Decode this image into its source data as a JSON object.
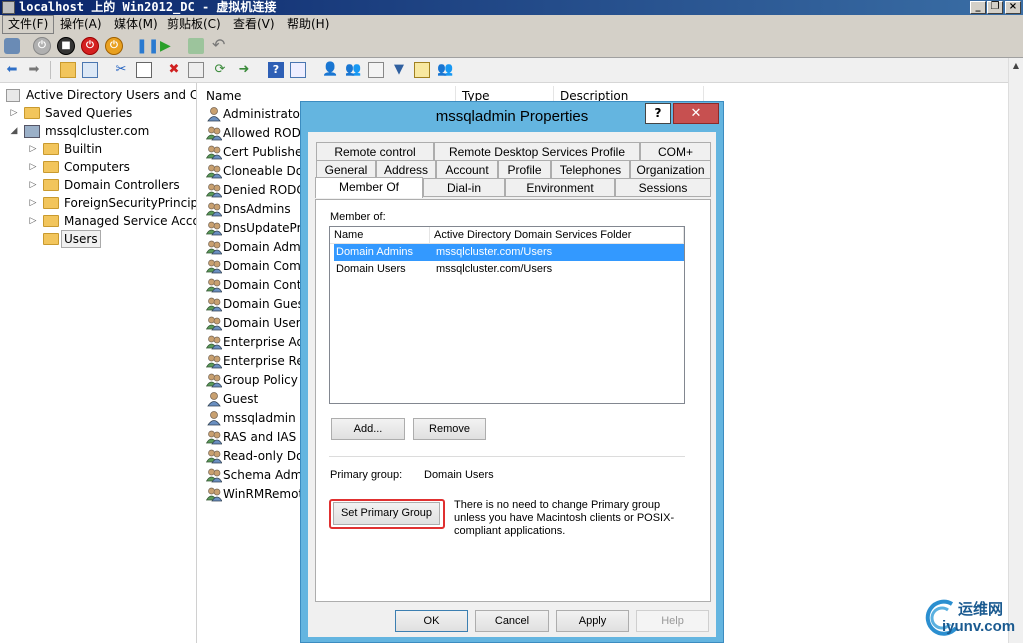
{
  "vm": {
    "title": "localhost 上的 Win2012_DC - 虚拟机连接",
    "menu": [
      "文件(F)",
      "操作(A)",
      "媒体(M)",
      "剪贴板(C)",
      "查看(V)",
      "帮助(H)"
    ]
  },
  "tree": {
    "root": "Active Directory Users and Com",
    "items": [
      {
        "label": "Saved Queries"
      },
      {
        "label": "mssqlcluster.com"
      },
      {
        "label": "Builtin"
      },
      {
        "label": "Computers"
      },
      {
        "label": "Domain Controllers"
      },
      {
        "label": "ForeignSecurityPrincipals"
      },
      {
        "label": "Managed Service Accour"
      },
      {
        "label": "Users"
      }
    ]
  },
  "list": {
    "columns": [
      "Name",
      "Type",
      "Description"
    ],
    "rows": [
      "Administrator",
      "Allowed RODC",
      "Cert Publishers",
      "Cloneable Don",
      "Denied RODC P",
      "DnsAdmins",
      "DnsUpdatePro",
      "Domain Admir",
      "Domain Comp",
      "Domain Contr",
      "Domain Guests",
      "Domain Users",
      "Enterprise Adm",
      "Enterprise Rea",
      "Group Policy C",
      "Guest",
      "mssqladmin",
      "RAS and IAS Se",
      "Read-only Dor",
      "Schema Admir",
      "WinRMRemote"
    ]
  },
  "dialog": {
    "title": "mssqladmin Properties",
    "help": "?",
    "close": "✕",
    "tabs_row1": [
      "Remote control",
      "Remote Desktop Services Profile",
      "COM+"
    ],
    "tabs_row2": [
      "General",
      "Address",
      "Account",
      "Profile",
      "Telephones",
      "Organization"
    ],
    "tabs_row3": [
      "Member Of",
      "Dial-in",
      "Environment",
      "Sessions"
    ],
    "member_of_label": "Member of:",
    "member_columns": [
      "Name",
      "Active Directory Domain Services Folder"
    ],
    "members": [
      {
        "name": "Domain Admins",
        "folder": "mssqlcluster.com/Users"
      },
      {
        "name": "Domain Users",
        "folder": "mssqlcluster.com/Users"
      }
    ],
    "add": "Add...",
    "remove": "Remove",
    "primary_group_label": "Primary group:",
    "primary_group_value": "Domain Users",
    "set_primary": "Set Primary Group",
    "note": "There is no need to change Primary group unless you have Macintosh clients or POSIX-compliant applications.",
    "ok": "OK",
    "cancel": "Cancel",
    "apply": "Apply",
    "help_btn": "Help"
  },
  "watermark": {
    "text1": "运维网",
    "text2": "iyunv.com"
  }
}
